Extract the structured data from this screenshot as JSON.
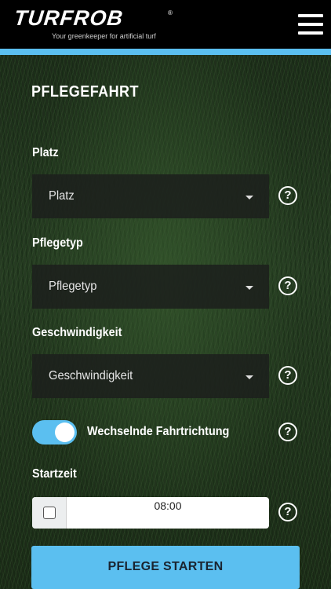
{
  "header": {
    "brand": "TURFROB",
    "registered": "®",
    "tagline": "Your greenkeeper for artificial turf",
    "menu_icon": "hamburger-menu-icon"
  },
  "colors": {
    "accent": "#5bbff0",
    "header_bg": "#000000",
    "field_bg": "#1c201c"
  },
  "page": {
    "title": "PFLEGEFAHRT"
  },
  "form": {
    "platz": {
      "label": "Platz",
      "selected": "Platz"
    },
    "pflegetyp": {
      "label": "Pflegetyp",
      "selected": "Pflegetyp"
    },
    "geschwindigkeit": {
      "label": "Geschwindigkeit",
      "selected": "Geschwindigkeit"
    },
    "direction_toggle": {
      "label": "Wechselnde Fahrtrichtung",
      "on": true
    },
    "startzeit": {
      "label": "Startzeit",
      "value": "08:00",
      "checked": false
    },
    "help_glyph": "?"
  },
  "actions": {
    "start_label": "PFLEGE STARTEN"
  }
}
